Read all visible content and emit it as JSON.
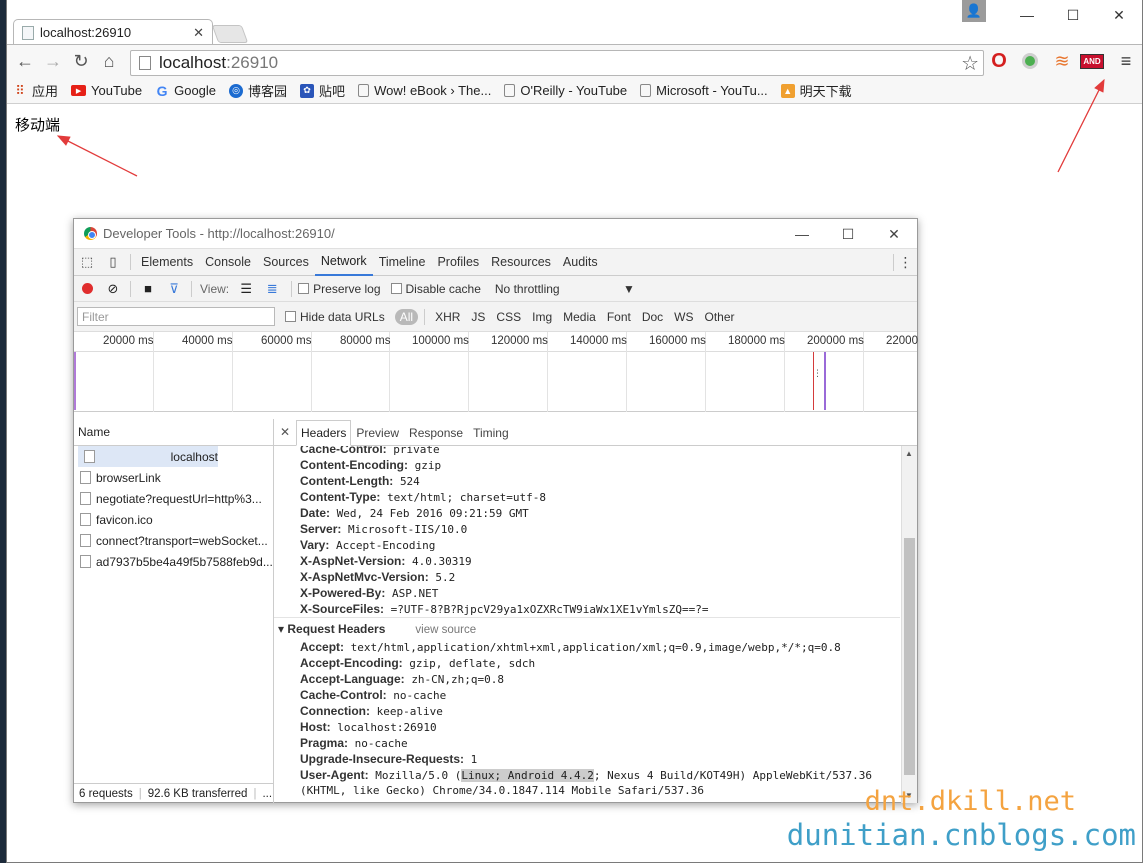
{
  "browser": {
    "tab_title": "localhost:26910",
    "url_host": "localhost",
    "url_port": ":26910",
    "win_minimize": "—",
    "win_maximize": "☐",
    "win_close": "✕",
    "extensions": [
      "opera-icon",
      "green-dot-icon",
      "sublime-icon",
      "and-icon"
    ],
    "and_badge": "AND"
  },
  "bookmarks": [
    {
      "label": "应用",
      "icon": "apps-grid-icon"
    },
    {
      "label": "YouTube",
      "icon": "youtube-icon"
    },
    {
      "label": "Google",
      "icon": "google-icon"
    },
    {
      "label": "博客园",
      "icon": "cnblogs-icon"
    },
    {
      "label": "贴吧",
      "icon": "tieba-icon"
    },
    {
      "label": "Wow! eBook › The...",
      "icon": "page-icon"
    },
    {
      "label": "O'Reilly - YouTube",
      "icon": "page-icon"
    },
    {
      "label": "Microsoft - YouTu...",
      "icon": "page-icon"
    },
    {
      "label": "明天下载",
      "icon": "download-icon"
    }
  ],
  "page": {
    "body_text": "移动端"
  },
  "devtools": {
    "title": "Developer Tools - http://localhost:26910/",
    "tabs": [
      "Elements",
      "Console",
      "Sources",
      "Network",
      "Timeline",
      "Profiles",
      "Resources",
      "Audits"
    ],
    "active_tab": "Network",
    "view_label": "View:",
    "preserve_log": "Preserve log",
    "disable_cache": "Disable cache",
    "throttling": "No throttling",
    "filter_placeholder": "Filter",
    "hide_data_urls": "Hide data URLs",
    "type_filters": [
      "All",
      "XHR",
      "JS",
      "CSS",
      "Img",
      "Media",
      "Font",
      "Doc",
      "WS",
      "Other"
    ],
    "timeline_ticks": [
      "20000 ms",
      "40000 ms",
      "60000 ms",
      "80000 ms",
      "100000 ms",
      "120000 ms",
      "140000 ms",
      "160000 ms",
      "180000 ms",
      "200000 ms",
      "22000"
    ],
    "name_header": "Name",
    "requests": [
      "localhost",
      "browserLink",
      "negotiate?requestUrl=http%3...",
      "favicon.ico",
      "connect?transport=webSocket...",
      "ad7937b5be4a49f5b7588feb9d..."
    ],
    "footer_requests": "6 requests",
    "footer_transferred": "92.6 KB transferred",
    "footer_more": "...",
    "detail_tabs": [
      "Headers",
      "Preview",
      "Response",
      "Timing"
    ],
    "response_headers": [
      {
        "k": "Cache-Control:",
        "v": "private"
      },
      {
        "k": "Content-Encoding:",
        "v": "gzip"
      },
      {
        "k": "Content-Length:",
        "v": "524"
      },
      {
        "k": "Content-Type:",
        "v": "text/html; charset=utf-8"
      },
      {
        "k": "Date:",
        "v": "Wed, 24 Feb 2016 09:21:59 GMT"
      },
      {
        "k": "Server:",
        "v": "Microsoft-IIS/10.0"
      },
      {
        "k": "Vary:",
        "v": "Accept-Encoding"
      },
      {
        "k": "X-AspNet-Version:",
        "v": "4.0.30319"
      },
      {
        "k": "X-AspNetMvc-Version:",
        "v": "5.2"
      },
      {
        "k": "X-Powered-By:",
        "v": "ASP.NET"
      },
      {
        "k": "X-SourceFiles:",
        "v": "=?UTF-8?B?RjpcV29ya1xOZXRcTW9iaWx1XE1vYmlsZQ==?="
      }
    ],
    "request_section": "Request Headers",
    "view_source": "view source",
    "request_headers": [
      {
        "k": "Accept:",
        "v": "text/html,application/xhtml+xml,application/xml;q=0.9,image/webp,*/*;q=0.8"
      },
      {
        "k": "Accept-Encoding:",
        "v": "gzip, deflate, sdch"
      },
      {
        "k": "Accept-Language:",
        "v": "zh-CN,zh;q=0.8"
      },
      {
        "k": "Cache-Control:",
        "v": "no-cache"
      },
      {
        "k": "Connection:",
        "v": "keep-alive"
      },
      {
        "k": "Host:",
        "v": "localhost:26910"
      },
      {
        "k": "Pragma:",
        "v": "no-cache"
      },
      {
        "k": "Upgrade-Insecure-Requests:",
        "v": "1"
      }
    ],
    "ua_key": "User-Agent:",
    "ua_pre": "Mozilla/5.0 (",
    "ua_highlight": "Linux; Android 4.4.2",
    "ua_post": "; Nexus 4 Build/KOT49H) AppleWebKit/537.36",
    "ua_line2": "(KHTML, like Gecko) Chrome/34.0.1847.114 Mobile Safari/537.36"
  },
  "watermark": {
    "line1": "dnt.dkill.net",
    "line2": "dunitian.cnblogs.com",
    "color1": "#f4a340",
    "color2": "#3f9fc8"
  },
  "colors": {
    "arrow": "#e23b3b",
    "accent": "#3879d9"
  }
}
